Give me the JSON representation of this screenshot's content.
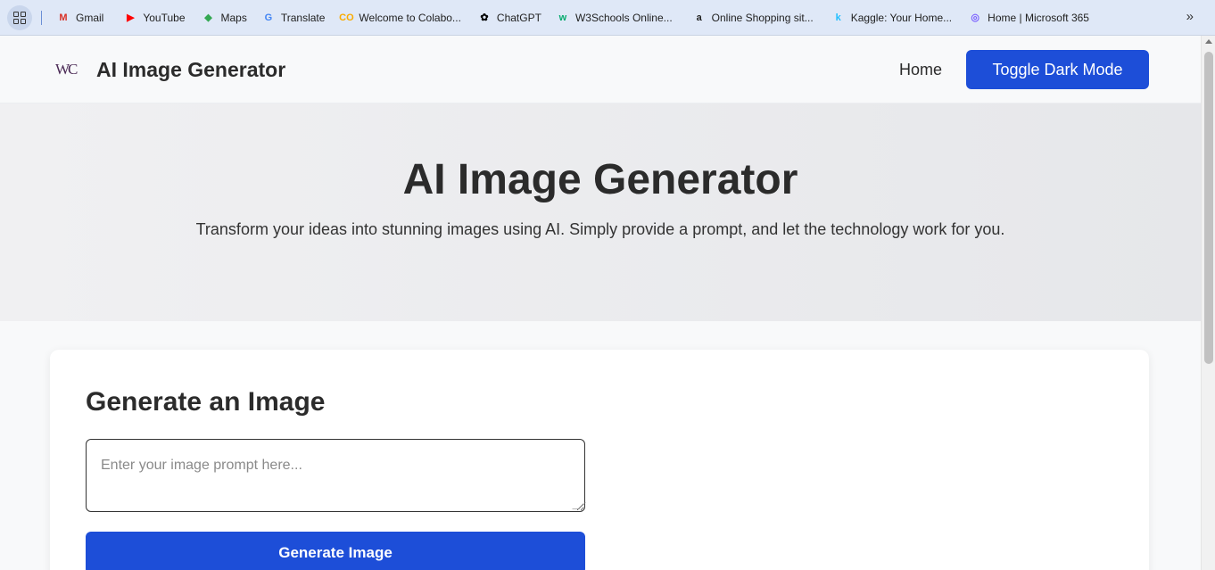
{
  "bookmarks": [
    {
      "label": "Gmail",
      "icon": "gmail-icon",
      "glyph": "M",
      "color": "#d93025"
    },
    {
      "label": "YouTube",
      "icon": "youtube-icon",
      "glyph": "▶",
      "color": "#ff0000"
    },
    {
      "label": "Maps",
      "icon": "maps-icon",
      "glyph": "◆",
      "color": "#34a853"
    },
    {
      "label": "Translate",
      "icon": "translate-icon",
      "glyph": "G",
      "color": "#4285f4"
    },
    {
      "label": "Welcome to Colabo...",
      "icon": "colab-icon",
      "glyph": "CO",
      "color": "#f9ab00"
    },
    {
      "label": "ChatGPT",
      "icon": "chatgpt-icon",
      "glyph": "✿",
      "color": "#000000"
    },
    {
      "label": "W3Schools Online...",
      "icon": "w3schools-icon",
      "glyph": "w",
      "color": "#04aa6d"
    },
    {
      "label": "Online Shopping sit...",
      "icon": "amazon-icon",
      "glyph": "a",
      "color": "#222222"
    },
    {
      "label": "Kaggle: Your Home...",
      "icon": "kaggle-icon",
      "glyph": "k",
      "color": "#20beff"
    },
    {
      "label": "Home | Microsoft 365",
      "icon": "microsoft365-icon",
      "glyph": "◎",
      "color": "#7b61ff"
    }
  ],
  "more_glyph": "»",
  "nav": {
    "logo_text": "WC",
    "brand": "AI Image Generator",
    "home": "Home",
    "toggle_dark": "Toggle Dark Mode"
  },
  "hero": {
    "title": "AI Image Generator",
    "subtitle": "Transform your ideas into stunning images using AI. Simply provide a prompt, and let the technology work for you."
  },
  "card": {
    "title": "Generate an Image",
    "prompt_placeholder": "Enter your image prompt here...",
    "generate_label": "Generate Image"
  },
  "colors": {
    "accent": "#1d4ed8"
  }
}
